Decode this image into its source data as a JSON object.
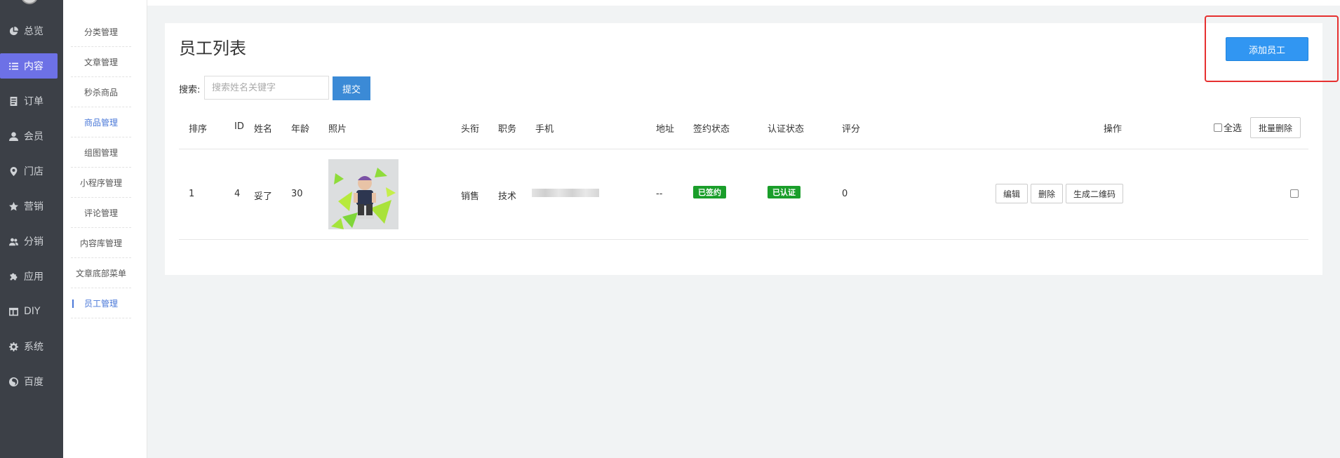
{
  "sidebar": {
    "items": [
      {
        "label": "总览",
        "icon": "pie-chart-icon"
      },
      {
        "label": "内容",
        "icon": "list-icon",
        "active": true
      },
      {
        "label": "订单",
        "icon": "document-icon"
      },
      {
        "label": "会员",
        "icon": "user-icon"
      },
      {
        "label": "门店",
        "icon": "location-pin-icon"
      },
      {
        "label": "营销",
        "icon": "star-icon"
      },
      {
        "label": "分销",
        "icon": "users-icon"
      },
      {
        "label": "应用",
        "icon": "puzzle-icon"
      },
      {
        "label": "DIY",
        "icon": "layout-icon"
      },
      {
        "label": "系统",
        "icon": "gear-icon"
      },
      {
        "label": "百度",
        "icon": "baidu-icon"
      }
    ]
  },
  "submenu": {
    "items": [
      {
        "label": "分类管理"
      },
      {
        "label": "文章管理"
      },
      {
        "label": "秒杀商品"
      },
      {
        "label": "商品管理"
      },
      {
        "label": "组图管理"
      },
      {
        "label": "小程序管理"
      },
      {
        "label": "评论管理"
      },
      {
        "label": "内容库管理"
      },
      {
        "label": "文章底部菜单"
      },
      {
        "label": "员工管理"
      }
    ]
  },
  "page": {
    "title": "员工列表",
    "add_button": "添加员工",
    "search_label": "搜索:",
    "search_placeholder": "搜索姓名关键字",
    "submit_button": "提交"
  },
  "table": {
    "headers": {
      "order": "排序",
      "id": "ID",
      "name": "姓名",
      "age": "年龄",
      "photo": "照片",
      "title": "头衔",
      "position": "职务",
      "phone": "手机",
      "address": "地址",
      "sign_status": "签约状态",
      "auth_status": "认证状态",
      "score": "评分",
      "actions": "操作",
      "select_all": "全选",
      "bulk_delete": "批量删除"
    },
    "rows": [
      {
        "order": "1",
        "id": "4",
        "name": "妥了",
        "age": "30",
        "title": "销售",
        "position": "技术",
        "address": "--",
        "sign_status": "已签约",
        "auth_status": "已认证",
        "score": "0",
        "edit": "编辑",
        "delete": "删除",
        "qrcode": "生成二维码"
      }
    ]
  },
  "colors": {
    "sidebar_bg": "#3c4047",
    "active_nav": "#6d71e6",
    "primary": "#3196f2",
    "badge_green": "#1a9e2a",
    "highlight_red": "#e63030"
  }
}
